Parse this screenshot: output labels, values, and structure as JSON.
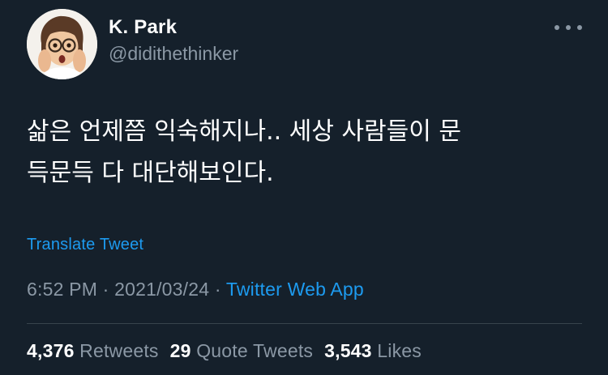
{
  "author": {
    "display_name": "K. Park",
    "handle": "@didithethinker",
    "avatar_icon": "memoji-face-avatar"
  },
  "tweet": {
    "text_line1": "삶은 언제쯤 익숙해지나.. 세상 사람들이 문",
    "text_line2": "득문득 다 대단해보인다.",
    "translate_label": "Translate Tweet",
    "time": "6:52 PM",
    "separator": " · ",
    "date": "2021/03/24",
    "source": "Twitter Web App"
  },
  "stats": {
    "retweets_count": "4,376",
    "retweets_label": " Retweets",
    "quote_count": "29",
    "quote_label": " Quote Tweets",
    "likes_count": "3,543",
    "likes_label": " Likes"
  },
  "colors": {
    "background": "#15202b",
    "primary_text": "#ffffff",
    "secondary_text": "#8b98a5",
    "link": "#1d9bf0",
    "divider": "#38444d"
  }
}
